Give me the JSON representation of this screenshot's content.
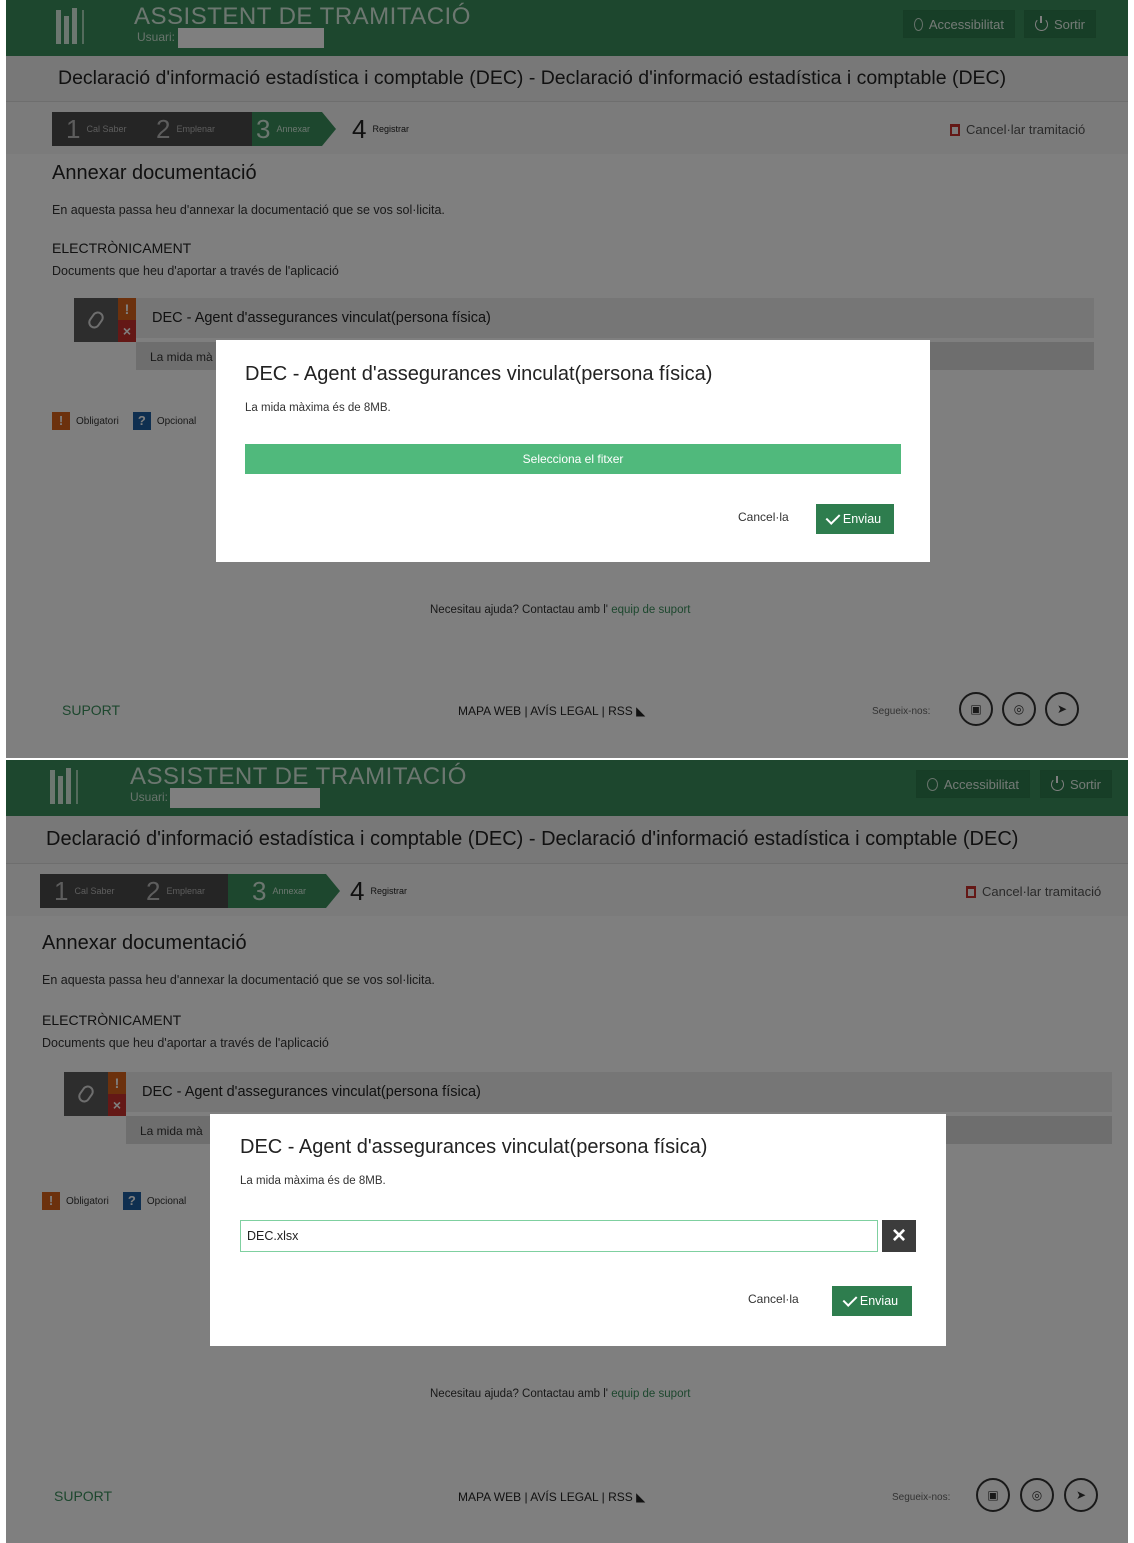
{
  "header": {
    "app_title": "ASSISTENT DE TRAMITACIÓ",
    "user_label": "Usuari:",
    "accessibility_label": "Accessibilitat",
    "logout_label": "Sortir"
  },
  "procedure_title": "Declaració d'informació estadística i comptable (DEC) - Declaració d'informació estadística i comptable (DEC)",
  "steps": [
    {
      "num": "1",
      "label": "Cal Saber"
    },
    {
      "num": "2",
      "label": "Emplenar"
    },
    {
      "num": "3",
      "label": "Annexar"
    },
    {
      "num": "4",
      "label": "Registrar"
    }
  ],
  "cancel_procedure_label": "Cancel·lar tramitació",
  "content": {
    "title": "Annexar documentació",
    "intro": "En aquesta passa heu d'annexar la documentació que se vos sol·licita.",
    "section_title": "ELECTRÒNICAMENT",
    "section_desc": "Documents que heu d'aportar a través de l'aplicació",
    "document_name": "DEC - Agent d'assegurances vinculat(persona física)",
    "document_sub_partial": "La mida mà",
    "legend_required": "Obligatori",
    "legend_optional": "Opcional"
  },
  "help": {
    "text": "Necesitau ajuda? Contactau amb l'",
    "link": "equip de suport"
  },
  "footer": {
    "support": "SUPORT",
    "links": "MAPA WEB  |  AVÍS LEGAL  |  RSS",
    "follow": "Segueix-nos:",
    "social": [
      "You Tube",
      "Instagram",
      "Twitter"
    ]
  },
  "modal1": {
    "title": "DEC - Agent d'assegurances vinculat(persona física)",
    "subtitle": "La mida màxima és de 8MB.",
    "select_label": "Selecciona el fitxer",
    "cancel_label": "Cancel·la",
    "send_label": "Enviau"
  },
  "modal2": {
    "title": "DEC - Agent d'assegurances vinculat(persona física)",
    "subtitle": "La mida màxima és de 8MB.",
    "file_value": "DEC.xlsx",
    "cancel_label": "Cancel·la",
    "send_label": "Enviau"
  },
  "colors": {
    "brand_green": "#3a8f5c",
    "select_green": "#50b97c",
    "send_green": "#2e7d4e",
    "required": "#d9631a",
    "optional": "#1f5fa0"
  }
}
